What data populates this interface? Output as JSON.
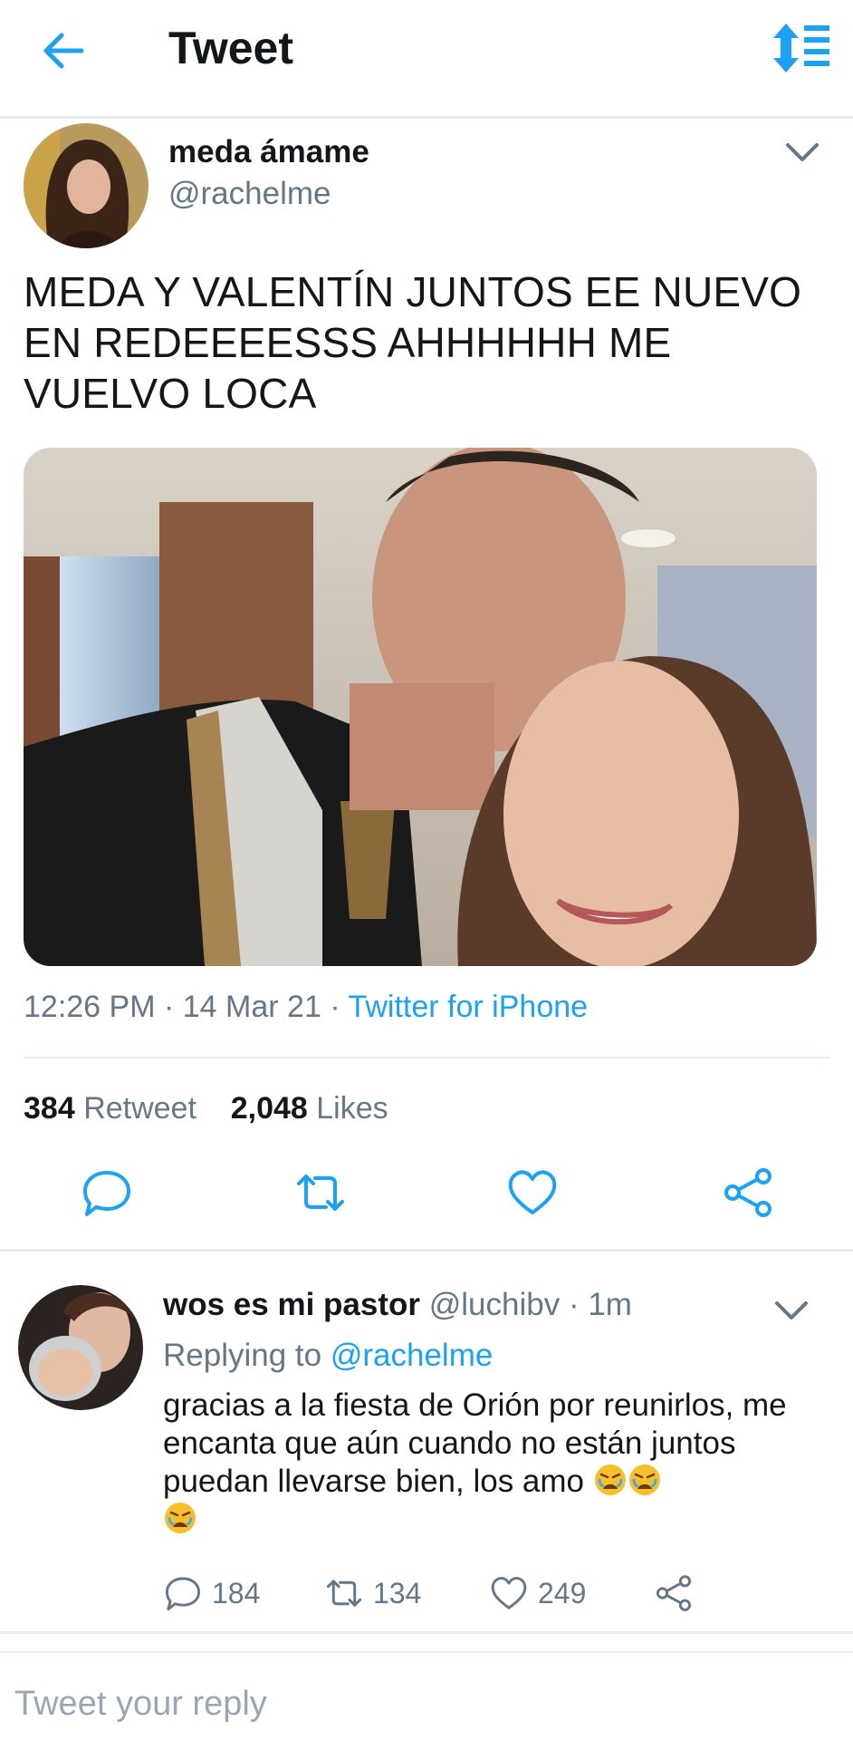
{
  "header": {
    "title": "Tweet",
    "back_icon": "arrow-left-icon",
    "sort_icon": "sort-toggle-icon"
  },
  "tweet": {
    "author_name": "meda ámame",
    "author_handle": "@rachelme",
    "text": "MEDA Y VALENTÍN JUNTOS EE NUEVO EN REDEEEESSS AHHHHHH ME VUELVO LOCA",
    "time": "12:26 PM",
    "date": "14 Mar 21",
    "separator": "·",
    "source": "Twitter for iPhone",
    "retweets": "384",
    "retweets_label": "Retweet",
    "likes": "2,048",
    "likes_label": "Likes"
  },
  "reply": {
    "author_name": "wos es mi pastor",
    "author_handle": "@luchibv",
    "separator": "·",
    "time": "1m",
    "replying_label": "Replying to",
    "replying_handle": "@rachelme",
    "text": "gracias a la fiesta de Orión por reunirlos, me encanta que aún cuando no están juntos puedan llevarse bien, los amo",
    "emoji_name": "crying-angry-face-icon",
    "reply_count": "184",
    "retweet_count": "134",
    "like_count": "249"
  },
  "composer": {
    "placeholder": "Tweet your reply"
  },
  "colors": {
    "accent": "#1da1f2",
    "text": "#14171a",
    "muted": "#657786",
    "divider": "#e6ecf0"
  }
}
